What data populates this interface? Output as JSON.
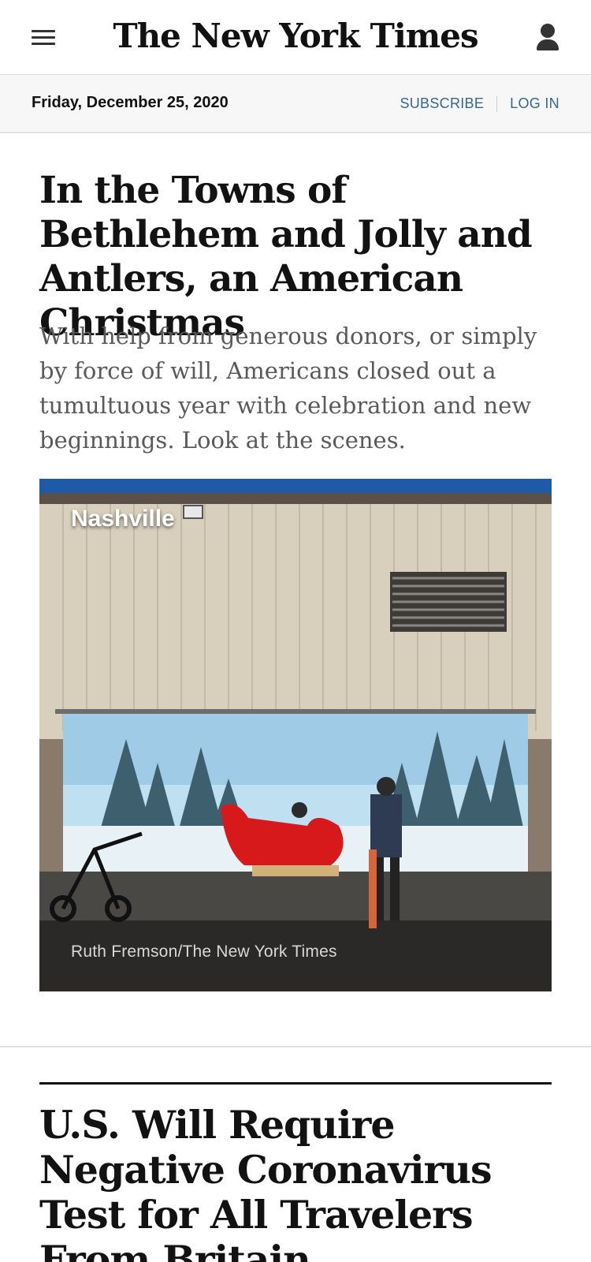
{
  "masthead": {
    "logo": "The New York Times",
    "menu_icon": "hamburger-menu-icon",
    "account_icon": "user-account-icon"
  },
  "datebar": {
    "date": "Friday, December 25, 2020",
    "subscribe": "SUBSCRIBE",
    "login": "LOG IN"
  },
  "articles": [
    {
      "headline": "In the Towns of Bethlehem and Jolly and Antlers, an American Christmas",
      "summary": "With help from generous donors, or simply by force of will, Americans closed out a tumultuous year with celebration and new beginnings. Look at the scenes.",
      "image": {
        "label": "Nashville",
        "credit": "Ruth Fremson/The New York Times"
      }
    },
    {
      "headline": "U.S. Will Require Negative Coronavirus Test for All Travelers From Britain"
    }
  ],
  "colors": {
    "link": "#326891",
    "text": "#121212",
    "summary": "#5a5a5a",
    "datebar_bg": "#f7f7f7"
  }
}
